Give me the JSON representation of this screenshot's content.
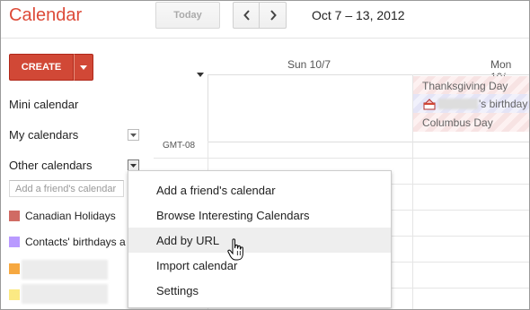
{
  "app": {
    "title": "Calendar"
  },
  "toolbar": {
    "today_label": "Today",
    "date_range": "Oct 7 – 13, 2012"
  },
  "sidebar": {
    "create_label": "CREATE",
    "mini_calendar_label": "Mini calendar",
    "my_calendars_label": "My calendars",
    "other_calendars_label": "Other calendars",
    "add_friend_placeholder": "Add a friend's calendar",
    "calendars": [
      {
        "label": "Canadian Holidays",
        "color": "#d06b64"
      },
      {
        "label": "Contacts' birthdays a",
        "color": "#b99aff"
      }
    ],
    "extra_swatch_colors": [
      "#f6a840",
      "#fbe983"
    ]
  },
  "grid": {
    "days": [
      "Sun 10/7",
      "Mon 10/"
    ],
    "timezone": "GMT-08",
    "all_day_events": [
      {
        "label": "Thanksgiving Day"
      },
      {
        "label": "'s birthday"
      },
      {
        "label": "Columbus Day"
      }
    ]
  },
  "menu": {
    "items": [
      {
        "label": "Add a friend's calendar"
      },
      {
        "label": "Browse Interesting Calendars"
      },
      {
        "label": "Add by URL"
      },
      {
        "label": "Import calendar"
      },
      {
        "label": "Settings"
      }
    ],
    "highlighted_index": 2
  },
  "colors": {
    "brand": "#dd4b39",
    "create_button": "#d14836",
    "event_red": "#f7e3e3",
    "event_blue": "#e4e4f6"
  }
}
